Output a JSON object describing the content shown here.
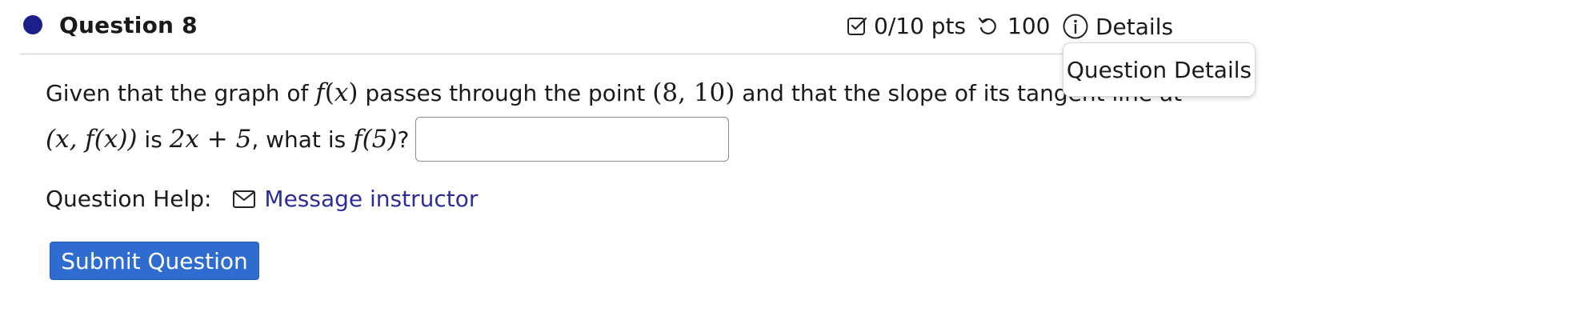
{
  "header": {
    "title": "Question 8",
    "points": "0/10 pts",
    "tries": "100",
    "details_label": "Details",
    "tooltip": "Question Details"
  },
  "question": {
    "line1_a": "Given that the graph of ",
    "f": "f",
    "lp": "(",
    "x": "x",
    "rp": ")",
    "line1_b": " passes through the point ",
    "point": "(8, 10)",
    "line1_c": " and that the slope of its tangent line at",
    "tangent_at": "(x, f(x))",
    "is": " is ",
    "slope_expr": "2x + 5",
    "what_is": ", what is ",
    "target": "f(5)",
    "qmark": "?",
    "answer_value": ""
  },
  "help": {
    "label": "Question Help:",
    "link": "Message instructor"
  },
  "submit_label": "Submit Question",
  "colors": {
    "accent": "#2e6ccf",
    "status_dot": "#1b1f8a",
    "link": "#2c2d9a"
  }
}
